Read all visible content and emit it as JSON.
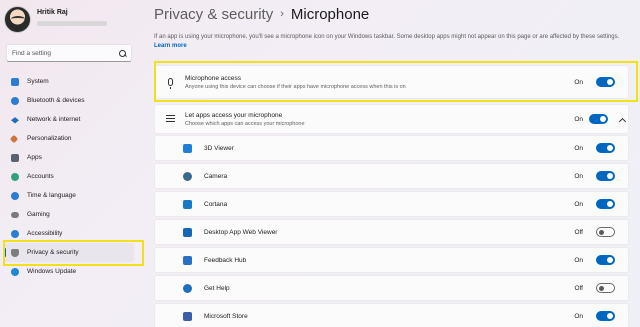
{
  "profile": {
    "name": "Hritik Raj"
  },
  "search": {
    "placeholder": "Find a setting"
  },
  "sidebar": {
    "items": [
      {
        "label": "System",
        "icon": "system-icon",
        "color": "#2b7cd3"
      },
      {
        "label": "Bluetooth & devices",
        "icon": "bluetooth-icon",
        "color": "#2b7cd3"
      },
      {
        "label": "Network & internet",
        "icon": "network-icon",
        "color": "#1e6fbf"
      },
      {
        "label": "Personalization",
        "icon": "personalization-icon",
        "color": "#d0743a"
      },
      {
        "label": "Apps",
        "icon": "apps-icon",
        "color": "#5a6170"
      },
      {
        "label": "Accounts",
        "icon": "accounts-icon",
        "color": "#2fa27a"
      },
      {
        "label": "Time & language",
        "icon": "time-language-icon",
        "color": "#2b7cd3"
      },
      {
        "label": "Gaming",
        "icon": "gaming-icon",
        "color": "#7a7a7a"
      },
      {
        "label": "Accessibility",
        "icon": "accessibility-icon",
        "color": "#2b7cd3"
      },
      {
        "label": "Privacy & security",
        "icon": "shield-icon",
        "color": "#7d7d7d",
        "active": true
      },
      {
        "label": "Windows Update",
        "icon": "windows-update-icon",
        "color": "#1e88d8"
      }
    ]
  },
  "header": {
    "breadcrumb": "Privacy & security",
    "separator": "›",
    "current": "Microphone"
  },
  "intro": {
    "text": "If an app is using your microphone, you'll see a microphone icon on your Windows taskbar. Some desktop apps might not appear on this page or are affected by these settings.",
    "link": "Learn more"
  },
  "mic_access": {
    "label": "Microphone access",
    "desc": "Anyone using this device can choose if their apps have microphone access when this is on",
    "state": "On",
    "on": true
  },
  "apps_access": {
    "label": "Let apps access your microphone",
    "desc": "Choose which apps can access your microphone",
    "state": "On",
    "on": true
  },
  "apps": [
    {
      "name": "3D Viewer",
      "state": "On",
      "on": true,
      "icon": "3d-viewer-icon",
      "color": "#1f7fd6"
    },
    {
      "name": "Camera",
      "state": "On",
      "on": true,
      "icon": "camera-icon",
      "color": "#3c6a8f"
    },
    {
      "name": "Cortana",
      "state": "On",
      "on": true,
      "icon": "cortana-icon",
      "color": "#1a78c8"
    },
    {
      "name": "Desktop App Web Viewer",
      "state": "Off",
      "on": false,
      "icon": "desktop-web-viewer-icon",
      "color": "#1667b8"
    },
    {
      "name": "Feedback Hub",
      "state": "On",
      "on": true,
      "icon": "feedback-hub-icon",
      "color": "#2a6fc4"
    },
    {
      "name": "Get Help",
      "state": "Off",
      "on": false,
      "icon": "get-help-icon",
      "color": "#1f6fbf"
    },
    {
      "name": "Microsoft Store",
      "state": "On",
      "on": true,
      "icon": "store-icon",
      "color": "#3a5fa8"
    }
  ]
}
